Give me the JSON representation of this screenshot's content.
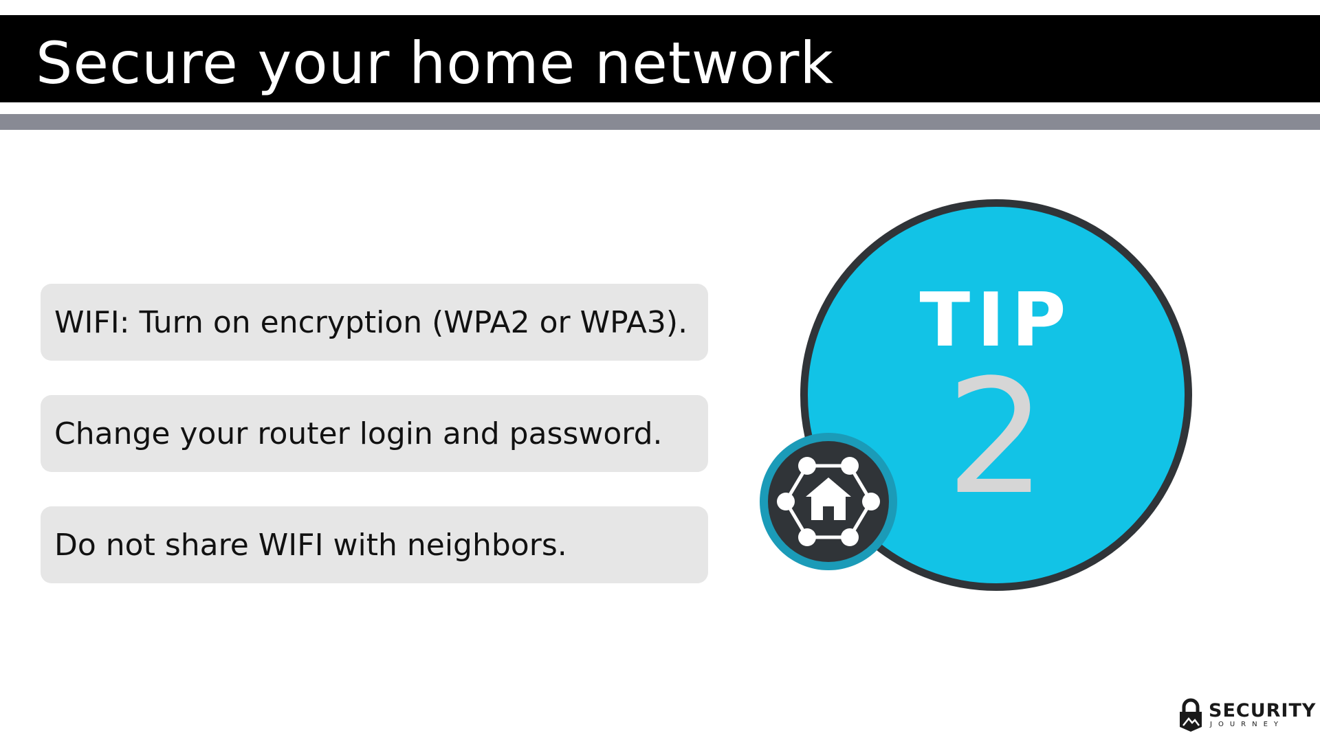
{
  "slide": {
    "title": "Secure your home network",
    "tips": [
      "WIFI: Turn on encryption (WPA2 or WPA3).",
      "Change your router login and password.",
      "Do not share WIFI with neighbors."
    ],
    "badge": {
      "label": "TIP",
      "number": "2",
      "icon": "home-network-icon"
    },
    "logo": {
      "name": "SECURITY",
      "subtitle": "JOURNEY"
    }
  },
  "colors": {
    "title_bar": "#000000",
    "accent_bar": "#888a94",
    "tip_box": "#e6e6e6",
    "badge_fill": "#12c3e6",
    "badge_border": "#303438",
    "icon_ring": "#1b9bb8",
    "icon_fill": "#303438"
  }
}
